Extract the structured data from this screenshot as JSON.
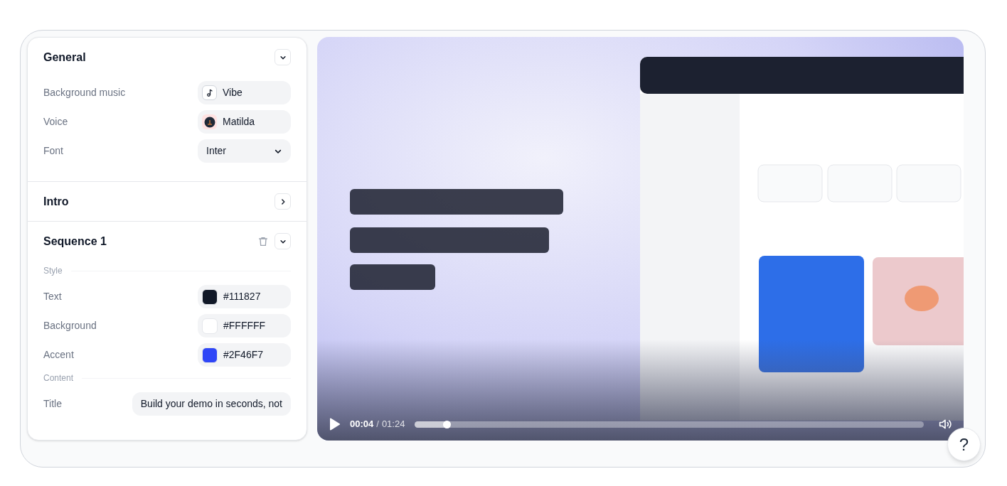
{
  "sections": [
    {
      "title": "General",
      "expanded": true,
      "deletable": false,
      "groups": [
        {
          "rows": [
            {
              "kind": "music",
              "label": "Background music",
              "value": "Vibe"
            },
            {
              "kind": "avatar",
              "label": "Voice",
              "value": "Matilda"
            },
            {
              "kind": "dropdown",
              "label": "Font",
              "value": "Inter"
            }
          ]
        }
      ]
    },
    {
      "title": "Intro",
      "expanded": false,
      "deletable": false
    },
    {
      "title": "Sequence 1",
      "expanded": true,
      "deletable": true,
      "groups": [
        {
          "heading": "Style",
          "rows": [
            {
              "kind": "color",
              "label": "Text",
              "value": "#111827",
              "color": "#111827"
            },
            {
              "kind": "color",
              "label": "Background",
              "value": "#FFFFFF",
              "color": "#ffffff"
            },
            {
              "kind": "color",
              "label": "Accent",
              "value": "#2F46F7",
              "color": "#2f46f7"
            }
          ]
        },
        {
          "heading": "Content",
          "rows": [
            {
              "kind": "text",
              "label": "Title",
              "value": "Build your demo in seconds, not"
            }
          ]
        }
      ]
    }
  ],
  "video": {
    "kind": "picture",
    "playing": false,
    "time": "00:04",
    "separator": "/",
    "duration": "01:24",
    "level": 0.062
  },
  "help": "?"
}
